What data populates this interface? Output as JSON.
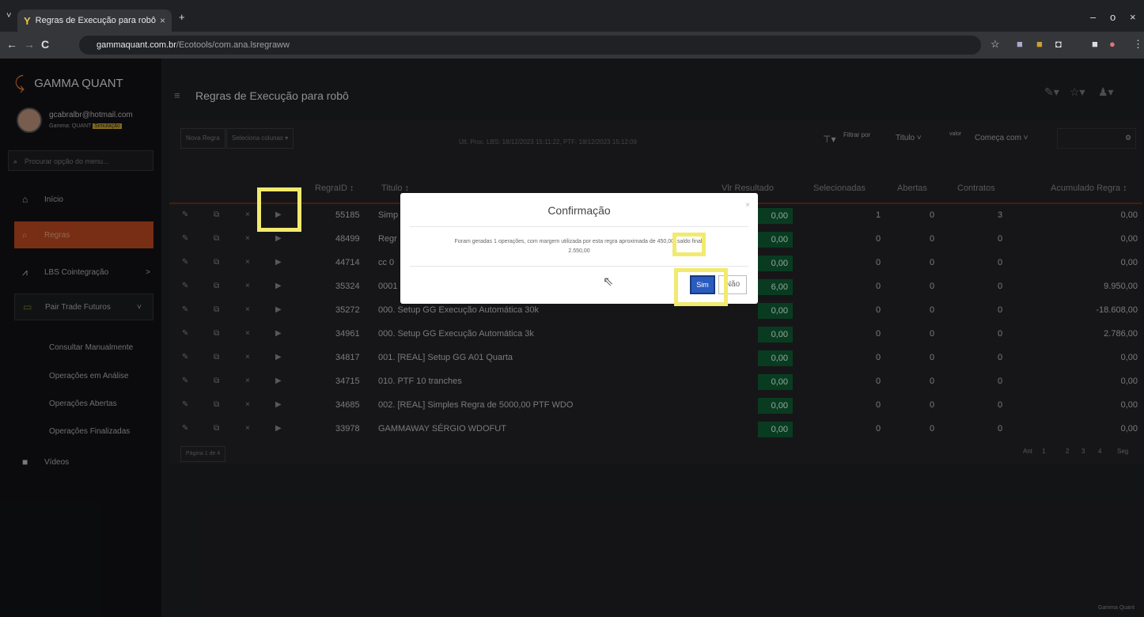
{
  "browser": {
    "tab_title": "Regras de Execução para robô",
    "tab_close": "×",
    "new_tab": "+",
    "url_domain": "gammaquant.com.br",
    "url_path": "/Ecotools/com.ana.lsregraww",
    "back": "←",
    "forward": "→",
    "reload": "C",
    "min": "–",
    "max": "o",
    "close": "×"
  },
  "sidebar": {
    "brand": "GAMMA QUANT",
    "user_email": "gcabralbr@hotmail.com",
    "user_plan_prefix": "Gamma: QUANT",
    "user_plan_tag": "Simulação",
    "search_placeholder": "Procurar opção do menu...",
    "items": [
      {
        "label": "Início",
        "icon": "home-icon"
      },
      {
        "label": "Regras",
        "icon": "search-icon"
      },
      {
        "label": "LBS Cointegração",
        "icon": "chart-icon",
        "chevron": ">"
      },
      {
        "label": "Pair Trade Futuros",
        "icon": "grid-icon",
        "chevron": "˅"
      },
      {
        "label": "Vídeos",
        "icon": "video-icon"
      }
    ],
    "subitems": [
      "Consultar Manualmente",
      "Operações em Análise",
      "Operações Abertas",
      "Operações Finalizadas"
    ]
  },
  "page": {
    "title": "Regras de Execução para robô",
    "new_rule": "Nova Regra",
    "select_columns": "Seleciona colunas ▾",
    "status": "Ult. Proc. LBS: 18/12/2023 15:11:22, PTF: 18/12/2023 15:12:09",
    "filter_by": "Filtrar por",
    "filter_field": "Titulo",
    "value_label": "valor",
    "filter_op": "Começa com",
    "footer": "Gamma Quant"
  },
  "table": {
    "headers": {
      "id": "RegraID",
      "title": "Titulo",
      "vlr": "Vlr Resultado",
      "sel": "Selecionadas",
      "open": "Abertas",
      "contracts": "Contratos",
      "acc": "Acumulado Regra"
    },
    "rows": [
      {
        "id": "55185",
        "title": "Simp",
        "vlr": "0,00",
        "sel": "1",
        "open": "0",
        "contracts": "3",
        "acc": "0,00"
      },
      {
        "id": "48499",
        "title": "Regr",
        "vlr": "0,00",
        "sel": "0",
        "open": "0",
        "contracts": "0",
        "acc": "0,00"
      },
      {
        "id": "44714",
        "title": "cc 0",
        "vlr": "0,00",
        "sel": "0",
        "open": "0",
        "contracts": "0",
        "acc": "0,00"
      },
      {
        "id": "35324",
        "title": "0001",
        "vlr": "6,00",
        "sel": "0",
        "open": "0",
        "contracts": "0",
        "acc": "9.950,00"
      },
      {
        "id": "35272",
        "title": "000. Setup GG Execução Automática 30k",
        "vlr": "0,00",
        "sel": "0",
        "open": "0",
        "contracts": "0",
        "acc": "-18.608,00"
      },
      {
        "id": "34961",
        "title": "000. Setup GG Execução Automática 3k",
        "vlr": "0,00",
        "sel": "0",
        "open": "0",
        "contracts": "0",
        "acc": "2.786,00"
      },
      {
        "id": "34817",
        "title": "001. [REAL] Setup GG A01 Quarta",
        "vlr": "0,00",
        "sel": "0",
        "open": "0",
        "contracts": "0",
        "acc": "0,00"
      },
      {
        "id": "34715",
        "title": "010. PTF 10 tranches",
        "vlr": "0,00",
        "sel": "0",
        "open": "0",
        "contracts": "0",
        "acc": "0,00"
      },
      {
        "id": "34685",
        "title": "002. [REAL] Simples Regra de 5000,00 PTF WDO",
        "vlr": "0,00",
        "sel": "0",
        "open": "0",
        "contracts": "0",
        "acc": "0,00"
      },
      {
        "id": "33978",
        "title": "GAMMAWAY SÉRGIO WDOFUT",
        "vlr": "0,00",
        "sel": "0",
        "open": "0",
        "contracts": "0",
        "acc": "0,00"
      }
    ],
    "page_info": "Página 1 de 4",
    "pager": {
      "prev": "Ant",
      "current": "1",
      "pages": [
        "2",
        "3",
        "4"
      ],
      "next": "Seg"
    }
  },
  "modal": {
    "title": "Confirmação",
    "close": "×",
    "message_a": "Foram geradas 1 operações, com margem utilizada por esta regra aproximada de",
    "amount": "450,00",
    "message_b": ", saldo final:",
    "message_c": "2.550,00",
    "confirm": "Sim",
    "cancel": "Não"
  }
}
